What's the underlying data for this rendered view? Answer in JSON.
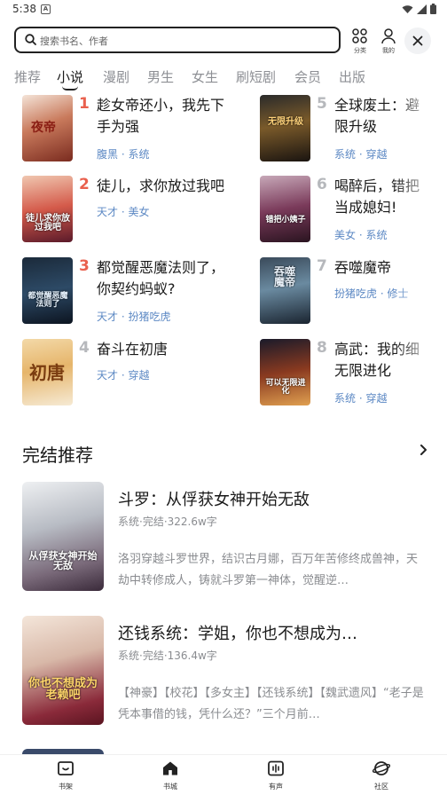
{
  "status_bar": {
    "time": "5:38"
  },
  "search": {
    "placeholder": "搜索书名、作者"
  },
  "top_actions": {
    "category_label": "分类",
    "mine_label": "我的"
  },
  "tabs": [
    "推荐",
    "小说",
    "漫剧",
    "男生",
    "女生",
    "刷短剧",
    "会员",
    "出版"
  ],
  "active_tab": "小说",
  "ranking": {
    "left": [
      {
        "num": "1",
        "title_line1": "趁女帝还小，我先下",
        "title_line2": "手为强",
        "tags": "腹黑 · 系统",
        "cover_text": "夜帝"
      },
      {
        "num": "2",
        "title_line1": "徒儿，求你放过我吧",
        "title_line2": "",
        "tags": "天才 · 美女",
        "cover_text": "徒儿求你放过我吧"
      },
      {
        "num": "3",
        "title_line1": "都觉醒恶魔法则了，",
        "title_line2": "你契约蚂蚁?",
        "tags": "天才 · 扮猪吃虎",
        "cover_text": "都觉醒恶魔法则了"
      },
      {
        "num": "4",
        "title_line1": "奋斗在初唐",
        "title_line2": "",
        "tags": "天才 · 穿越",
        "cover_text": "初唐"
      }
    ],
    "right": [
      {
        "num": "5",
        "title_line1": "全球废土：避",
        "title_line2": "限升级",
        "tags": "系统 · 穿越",
        "cover_text": "无限升级"
      },
      {
        "num": "6",
        "title_line1": "喝醉后，错把",
        "title_line2": "当成媳妇!",
        "tags": "美女 · 系统",
        "cover_text": "错把小姨子"
      },
      {
        "num": "7",
        "title_line1": "吞噬魔帝",
        "title_line2": "",
        "tags": "扮猪吃虎 · 修士",
        "cover_text": "吞噬魔帝"
      },
      {
        "num": "8",
        "title_line1": "高武：我的细",
        "title_line2": "无限进化",
        "tags": "系统 · 穿越",
        "cover_text": "可以无限进化"
      }
    ]
  },
  "finished_section": {
    "title": "完结推荐",
    "items": [
      {
        "title": "斗罗：从俘获女神开始无敌",
        "meta": "系统·完结·322.6w字",
        "desc": "洛羽穿越斗罗世界，结识古月娜，百万年苦修终成兽神，天劫中转修成人，铸就斗罗第一神体，觉醒逆…",
        "cover_text": "从俘获女神开始无敌"
      },
      {
        "title": "还钱系统：学姐，你也不想成为…",
        "meta": "系统·完结·136.4w字",
        "desc": "【神豪】【校花】【多女主】【还钱系统】【魏武遗风】“老子是凭本事借的钱，凭什么还？”三个月前…",
        "cover_text": "你也不想成为老赖吧"
      }
    ]
  },
  "bottom_nav": [
    "书架",
    "书城",
    "有声",
    "社区"
  ],
  "colors": {
    "rank_top3": "#e9604d",
    "rank_rest": "#b6b8bc",
    "tag": "#5d89c4"
  }
}
